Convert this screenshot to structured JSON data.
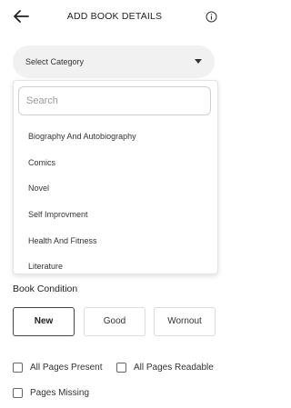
{
  "header": {
    "title": "ADD BOOK DETAILS",
    "back_icon": "arrow-left-icon",
    "info_icon": "info-circle-icon"
  },
  "category": {
    "label": "Select Category",
    "caret_icon": "caret-down-icon"
  },
  "dropdown": {
    "search_placeholder": "Search",
    "items": [
      "Biography And Autobiography",
      "Comics",
      "Novel",
      "Self Improvment",
      "Health And Fitness",
      "Literature"
    ]
  },
  "condition": {
    "title": "Book Condition",
    "options": [
      "New",
      "Good",
      "Wornout"
    ],
    "selected": "New"
  },
  "checks": [
    {
      "label": "All Pages Present",
      "checked": false
    },
    {
      "label": "All Pages Readable",
      "checked": false
    },
    {
      "label": "Pages Missing",
      "checked": false
    }
  ]
}
